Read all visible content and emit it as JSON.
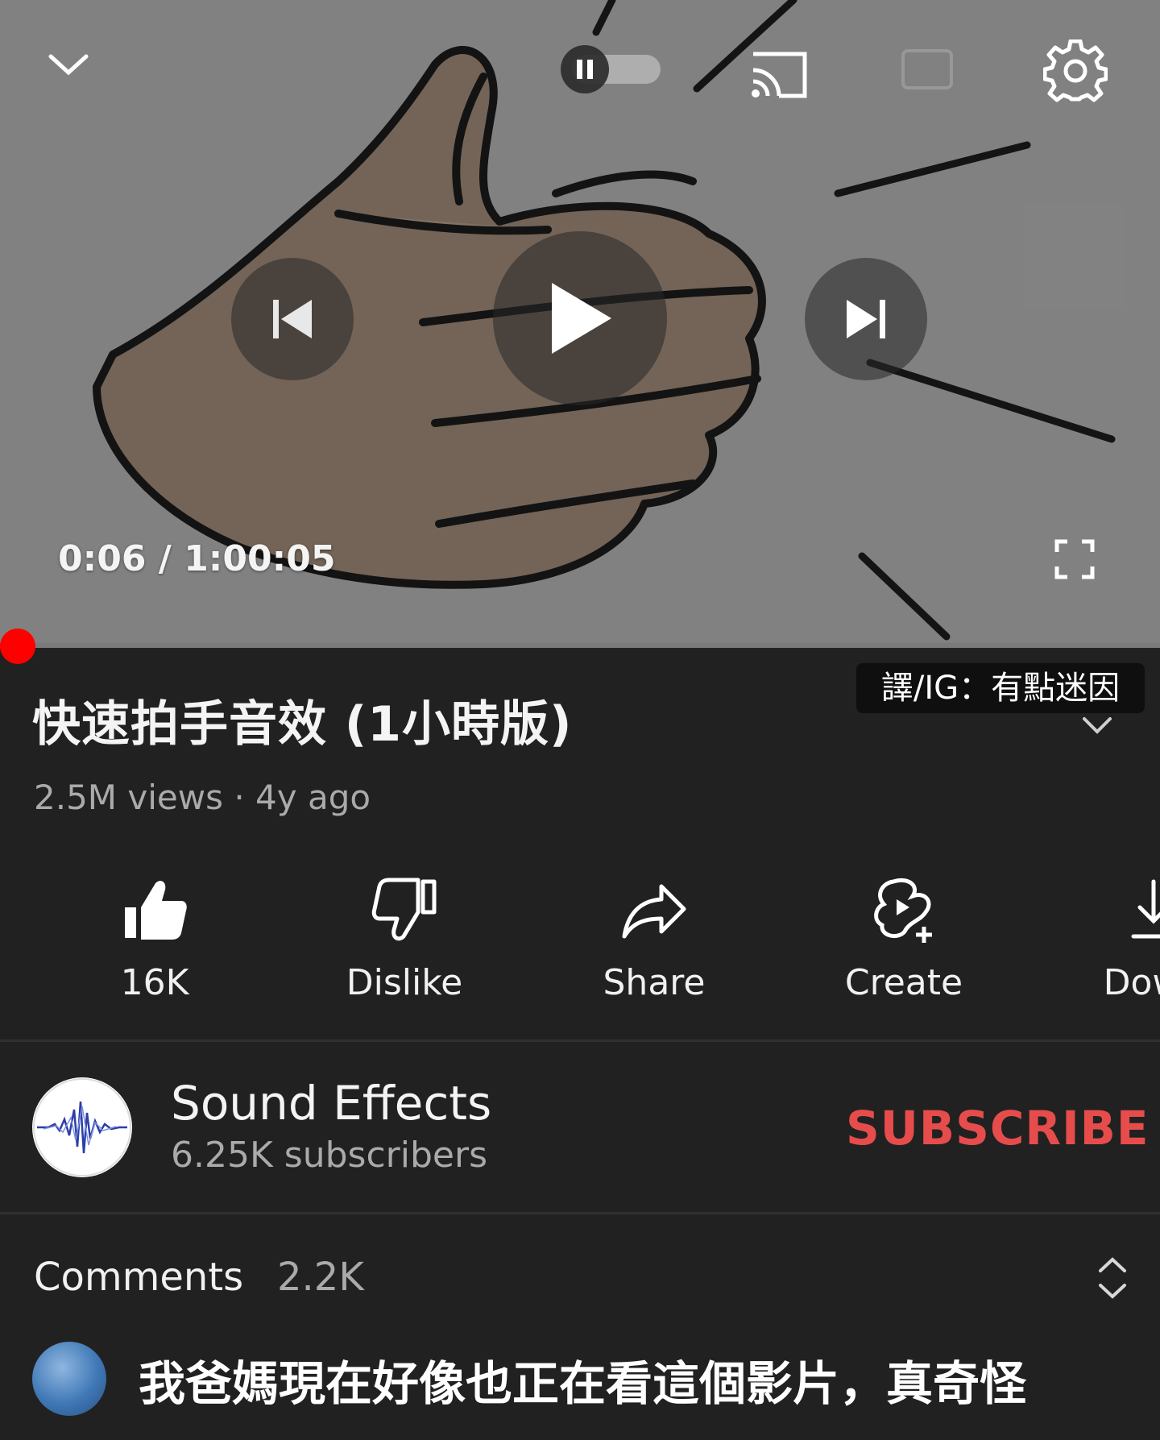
{
  "player": {
    "current_time": "0:06",
    "time_separator": "/",
    "duration": "1:00:05",
    "progress_fraction": 0.0017,
    "autoplay_on": true,
    "icons": {
      "collapse": "chevron-down-icon",
      "autoplay": "autoplay-toggle-icon",
      "cast": "cast-icon",
      "captions": "cc-icon",
      "settings": "gear-icon",
      "previous": "skip-previous-icon",
      "play": "play-icon",
      "next": "skip-next-icon",
      "fullscreen": "fullscreen-icon"
    }
  },
  "watermark": "譯/IG：有點迷因",
  "video": {
    "title": "快速拍手音效 (1小時版)",
    "meta": "2.5M views · 4y ago"
  },
  "actions": [
    {
      "label": "16K",
      "icon": "thumbs-up-icon"
    },
    {
      "label": "Dislike",
      "icon": "thumbs-down-icon"
    },
    {
      "label": "Share",
      "icon": "share-icon"
    },
    {
      "label": "Create",
      "icon": "create-icon"
    },
    {
      "label": "Down",
      "icon": "download-icon"
    }
  ],
  "channel": {
    "name": "Sound Effects",
    "subscribers": "6.25K subscribers",
    "subscribe_label": "SUBSCRIBE"
  },
  "comments": {
    "title": "Comments",
    "count": "2.2K",
    "first_comment": "我爸媽現在好像也正在看這個影片，真奇怪"
  },
  "colors": {
    "background": "#212121",
    "accent_red": "#ff0000",
    "subscribe_red": "#e74c4c",
    "secondary_text": "#aaaaaa"
  }
}
